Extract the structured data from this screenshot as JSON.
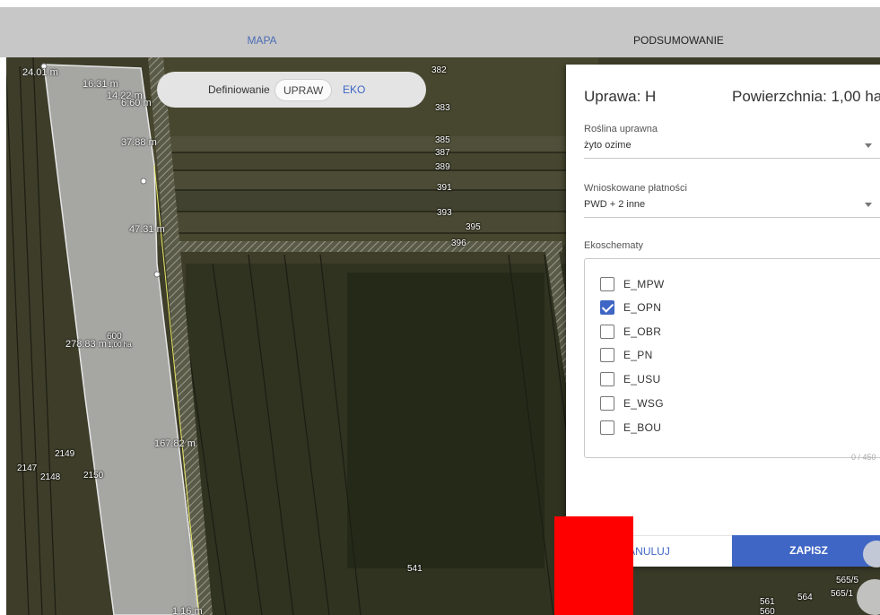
{
  "tabs": [
    {
      "label": "MAPA",
      "active": true
    },
    {
      "label": "PODSUMOWANIE",
      "active": false
    }
  ],
  "definition_bar": {
    "label": "Definiowanie",
    "options": [
      "UPRAW",
      "EKO"
    ],
    "selected": "UPRAW"
  },
  "map": {
    "parcel_labels": [
      "382",
      "383",
      "385",
      "387",
      "389",
      "391",
      "393",
      "395",
      "396",
      "2149",
      "2147",
      "2148",
      "2150",
      "541",
      "561",
      "564",
      "565/1",
      "565/5",
      "560"
    ],
    "area_label": "600",
    "area_sub": "1,00 ha",
    "measurements": [
      "24.01 m",
      "16.31 m",
      "14.22 m",
      "6.60 m",
      "37.88 m",
      "47.31 m",
      "278.83 m",
      "167.82 m",
      "1.16 m"
    ]
  },
  "panel": {
    "title": "Uprawa: H",
    "area": "Powierzchnia: 1,00 ha",
    "crop_label": "Roślina uprawna",
    "crop_value": "żyto ozime",
    "payments_label": "Wnioskowane płatności",
    "payments_value": "PWD + 2 inne",
    "eco_label": "Ekoschematy",
    "eco_items": [
      {
        "label": "E_MPW",
        "checked": false
      },
      {
        "label": "E_OPN",
        "checked": true
      },
      {
        "label": "E_OBR",
        "checked": false
      },
      {
        "label": "E_PN",
        "checked": false
      },
      {
        "label": "E_USU",
        "checked": false
      },
      {
        "label": "E_WSG",
        "checked": false
      },
      {
        "label": "E_BOU",
        "checked": false
      }
    ],
    "counter": "0 / 450",
    "cancel_label": "ANULUJ",
    "save_label": "ZAPISZ"
  },
  "colors": {
    "accent": "#3f66c4",
    "redaction": "#ff0000"
  }
}
